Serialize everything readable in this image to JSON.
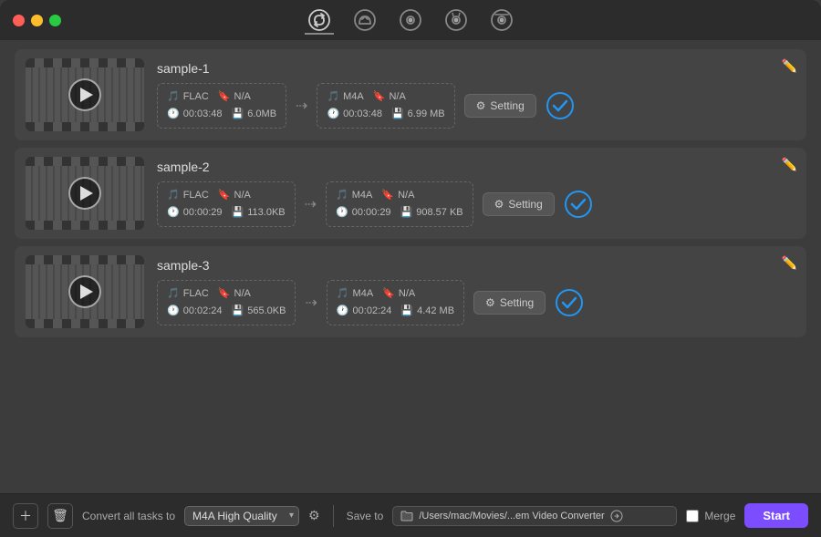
{
  "titlebar": {
    "traffic_lights": [
      "red",
      "yellow",
      "green"
    ]
  },
  "nav": {
    "icons": [
      {
        "name": "convert-icon",
        "label": "Convert",
        "active": true
      },
      {
        "name": "rotate-icon",
        "label": "Rotate"
      },
      {
        "name": "disc-icon",
        "label": "Disc"
      },
      {
        "name": "film-icon",
        "label": "Film"
      },
      {
        "name": "dvd-icon",
        "label": "DVD"
      }
    ]
  },
  "items": [
    {
      "id": "sample-1",
      "title": "sample-1",
      "source": {
        "format": "FLAC",
        "extra": "N/A",
        "duration": "00:03:48",
        "size": "6.0MB"
      },
      "output": {
        "format": "M4A",
        "extra": "N/A",
        "duration": "00:03:48",
        "size": "6.99 MB"
      },
      "setting_label": "Setting",
      "checked": true
    },
    {
      "id": "sample-2",
      "title": "sample-2",
      "source": {
        "format": "FLAC",
        "extra": "N/A",
        "duration": "00:00:29",
        "size": "113.0KB"
      },
      "output": {
        "format": "M4A",
        "extra": "N/A",
        "duration": "00:00:29",
        "size": "908.57 KB"
      },
      "setting_label": "Setting",
      "checked": true
    },
    {
      "id": "sample-3",
      "title": "sample-3",
      "source": {
        "format": "FLAC",
        "extra": "N/A",
        "duration": "00:02:24",
        "size": "565.0KB"
      },
      "output": {
        "format": "M4A",
        "extra": "N/A",
        "duration": "00:02:24",
        "size": "4.42 MB"
      },
      "setting_label": "Setting",
      "checked": true
    }
  ],
  "bottombar": {
    "convert_label": "Convert all tasks to",
    "convert_preset": "M4A High Quality",
    "save_to_label": "Save to",
    "save_to_path": "/Users/mac/Movies/...em Video Converter",
    "merge_label": "Merge",
    "start_label": "Start"
  }
}
